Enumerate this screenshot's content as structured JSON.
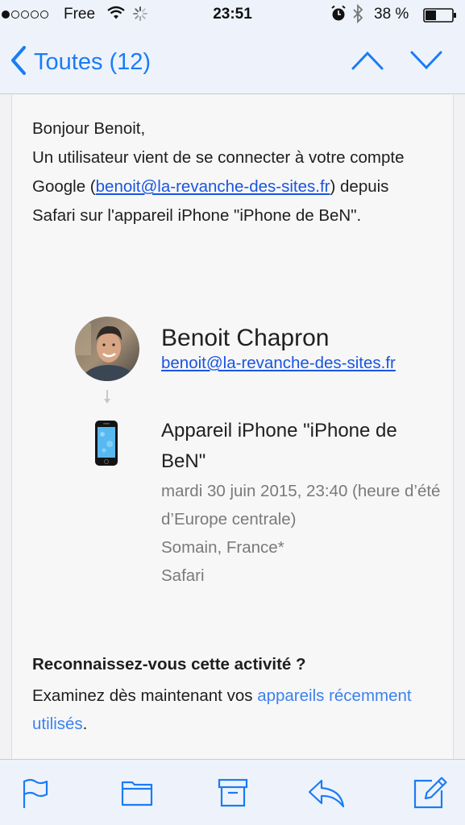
{
  "status_bar": {
    "carrier": "Free",
    "time": "23:51",
    "battery_percent": "38 %",
    "signal_bars_filled": 1,
    "signal_bars_total": 5
  },
  "nav": {
    "back_label": "Toutes (12)",
    "up_icon": "chevron-up-icon",
    "down_icon": "chevron-down-icon"
  },
  "email": {
    "greeting": "Bonjour Benoit,",
    "intro_before_link": "Un utilisateur vient de se connecter à votre compte Google (",
    "intro_link": "benoit@la-revanche-des-sites.fr",
    "intro_after_link": ") depuis Safari sur l'appareil iPhone \"iPhone de BeN\".",
    "user_name": "Benoit Chapron",
    "user_email": "benoit@la-revanche-des-sites.fr",
    "device_name": "Appareil iPhone \"iPhone de BeN\"",
    "date": "mardi 30 juin 2015, 23:40 (heure d’été d’Europe centrale)",
    "location": "Somain, France*",
    "browser": "Safari",
    "question": "Reconnaissez-vous cette activité ?",
    "review_text": "Examinez dès maintenant vos ",
    "review_link": "appareils récemment utilisés",
    "review_end": "."
  },
  "toolbar": {
    "icons": [
      "flag-icon",
      "folder-icon",
      "archive-icon",
      "reply-icon",
      "compose-icon"
    ]
  },
  "colors": {
    "accent": "#1a7cf5",
    "link": "#1a55e0",
    "bar_background": "#eef3fb"
  }
}
